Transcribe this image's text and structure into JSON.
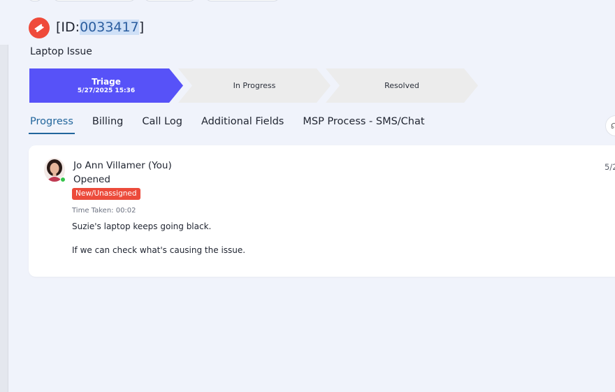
{
  "ticket": {
    "id_prefix": "[ID:",
    "id_number": "0033417",
    "id_suffix": "]",
    "subject": "Laptop Issue"
  },
  "pipeline": {
    "stages": [
      {
        "name": "Triage",
        "date": "5/27/2025 15:36",
        "active": true
      },
      {
        "name": "In Progress",
        "active": false
      },
      {
        "name": "Resolved",
        "active": false
      }
    ],
    "active_color": "#5752f8"
  },
  "tabs": [
    {
      "label": "Progress",
      "active": true
    },
    {
      "label": "Billing"
    },
    {
      "label": "Call Log"
    },
    {
      "label": "Additional Fields"
    },
    {
      "label": "MSP Process - SMS/Chat"
    }
  ],
  "progress_entry": {
    "author": "Jo Ann Villamer (You)",
    "action": "Opened",
    "status": "New/Unassigned",
    "time_taken": "Time Taken: 00:02",
    "date_partial": "5/2",
    "messages": [
      "Suzie's laptop keeps going black.",
      "If we can check what's causing the issue."
    ]
  },
  "colors": {
    "ticket_icon": "#ef4a3a",
    "status_badge": "#ec4b3b",
    "tab_active": "#22669c",
    "online": "#35c44a"
  }
}
